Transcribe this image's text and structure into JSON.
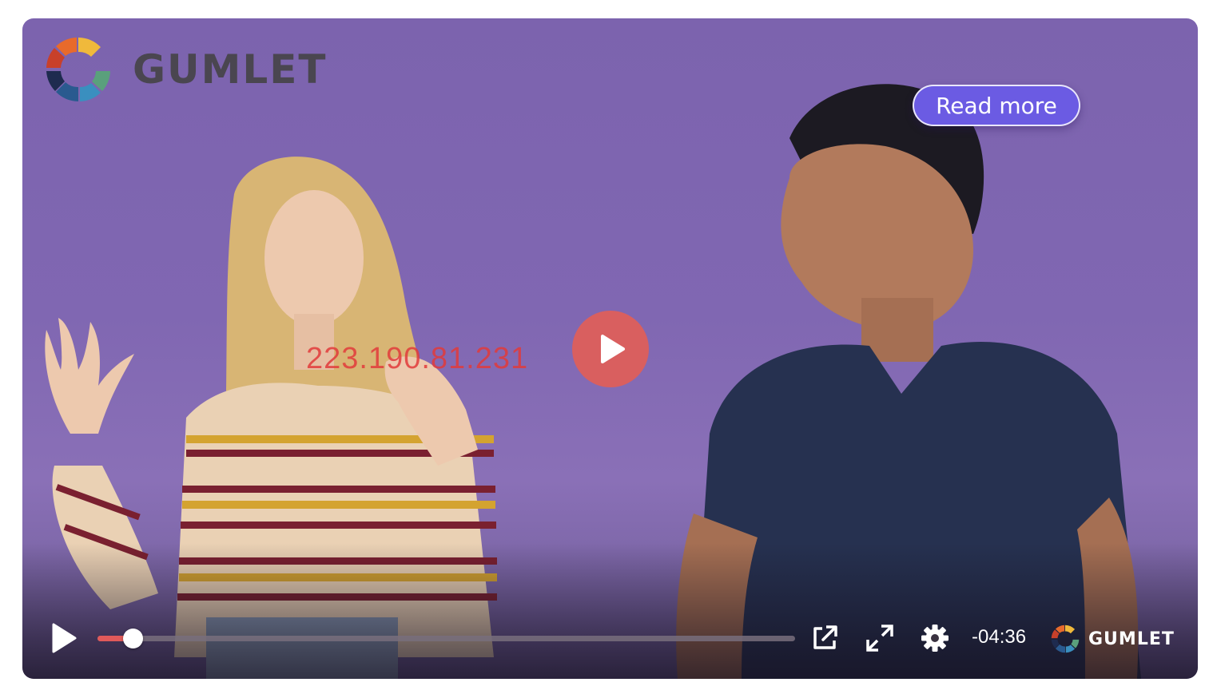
{
  "brand": {
    "name": "GUMLET",
    "logo_icon": "gumlet-logo-icon",
    "logo_colors": [
      "#e3772f",
      "#f0b93b",
      "#5aa07c",
      "#3a8fbf",
      "#2a5a8f",
      "#1e2b4f",
      "#c8402a",
      "#e86a2b"
    ]
  },
  "overlay": {
    "read_more_label": "Read more",
    "ip_watermark": "223.190.81.231"
  },
  "controls": {
    "play_icon": "play-icon",
    "progress": 0.05,
    "share_icon": "external-link-icon",
    "fullscreen_icon": "fullscreen-icon",
    "settings_icon": "gear-icon",
    "time_remaining": "-04:36"
  },
  "colors": {
    "accent": "#e05a5a",
    "read_more_bg": "#6b5be3",
    "background": "#7c63ae"
  }
}
